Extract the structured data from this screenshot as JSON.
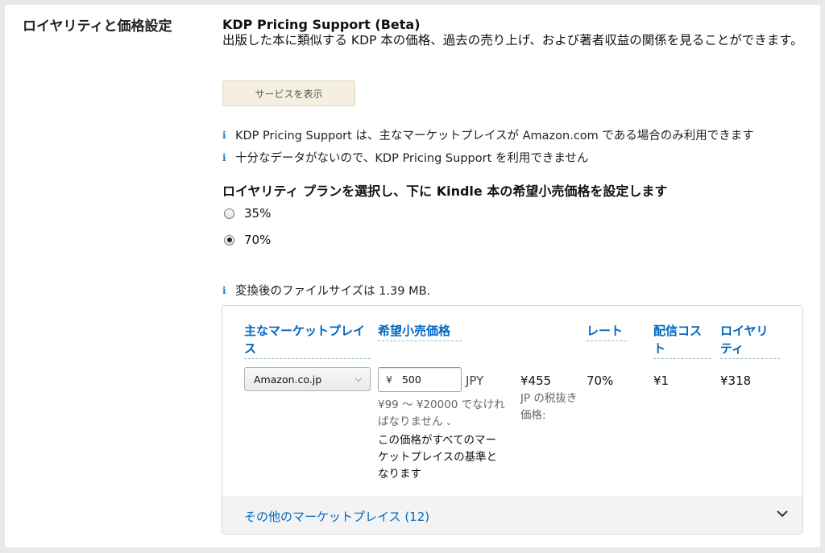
{
  "section": {
    "label": "ロイヤリティと価格設定"
  },
  "pricing_support": {
    "title": "KDP Pricing Support (Beta)",
    "description": "出版した本に類似する KDP 本の価格、過去の売り上げ、および著者収益の関係を見ることができます。",
    "button_label": "サービスを表示"
  },
  "info": {
    "icon": "info-icon",
    "line1": "KDP Pricing Support は、主なマーケットプレイスが Amazon.com である場合のみ利用できます",
    "line2": "十分なデータがないので、KDP Pricing Support を利用できません",
    "file_size": "変換後のファイルサイズは 1.39 MB."
  },
  "plan": {
    "heading": "ロイヤリティ プランを選択し、下に Kindle 本の希望小売価格を設定します",
    "options": [
      {
        "label": "35%",
        "selected": false
      },
      {
        "label": "70%",
        "selected": true
      }
    ]
  },
  "table": {
    "headers": {
      "marketplace": "主なマーケットプレイス",
      "list_price": "希望小売価格",
      "rate": "レート",
      "delivery_cost": "配信コスト",
      "royalty": "ロイヤリティ"
    },
    "row": {
      "marketplace": "Amazon.co.jp",
      "currency_symbol": "¥",
      "price": "500",
      "currency": "JPY",
      "range_note": "¥99 ～ ¥20000 でなければなりません",
      "base_note": "この価格がすべてのマーケットプレイスの基準となります",
      "price_ex_tax": "¥455",
      "tax_note": "JP の税抜き価格:",
      "rate": "70%",
      "delivery_cost": "¥1",
      "royalty": "¥318"
    },
    "footer_link": "その他のマーケットプレイス (12)"
  },
  "colors": {
    "link": "#0066c0",
    "info_icon": "#2b7bb9",
    "button_bg": "#f5efe2"
  }
}
